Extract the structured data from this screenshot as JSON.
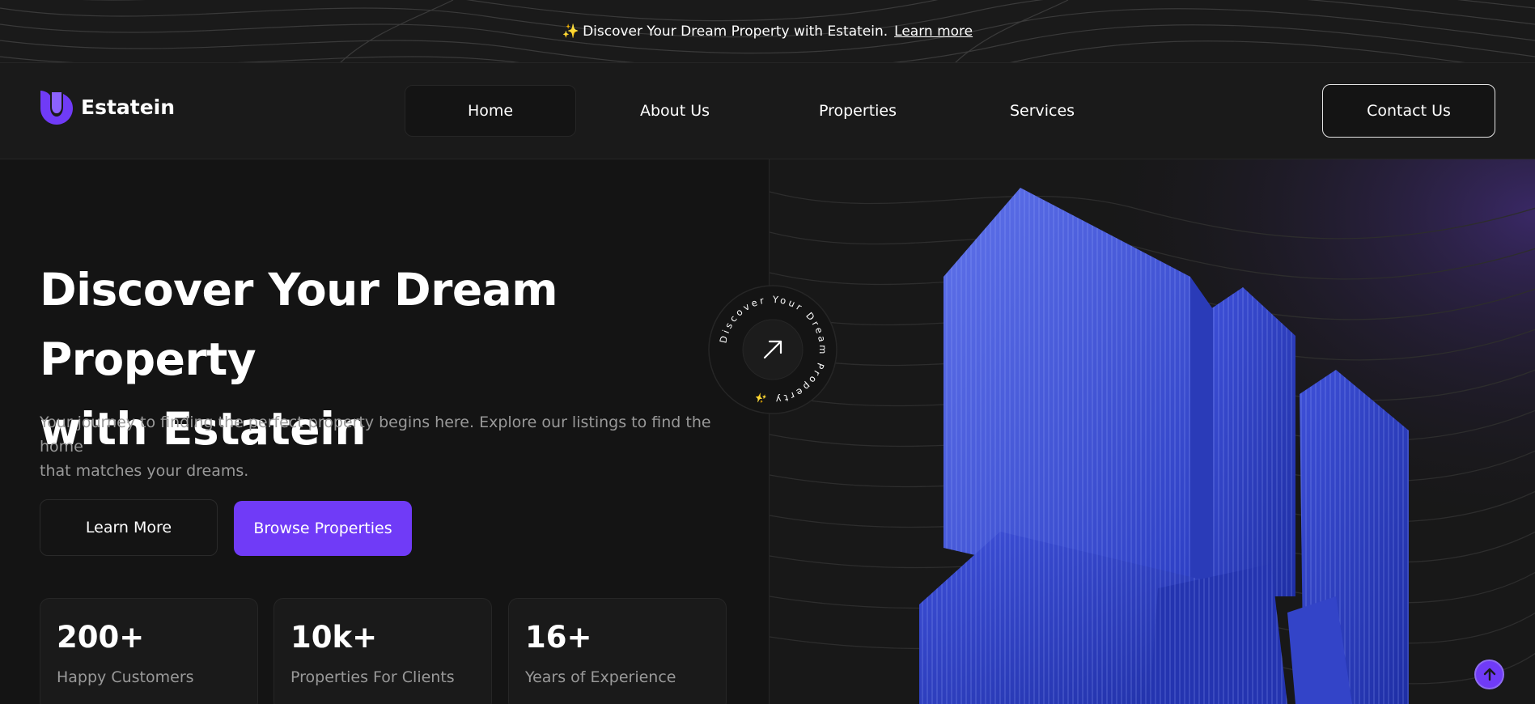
{
  "banner": {
    "text": "Discover Your Dream Property with Estatein.",
    "link": "Learn more"
  },
  "logo": {
    "name": "Estatein"
  },
  "nav": {
    "items": [
      {
        "label": "Home",
        "active": true
      },
      {
        "label": "About Us",
        "active": false
      },
      {
        "label": "Properties",
        "active": false
      },
      {
        "label": "Services",
        "active": false
      }
    ],
    "contact": "Contact Us"
  },
  "hero": {
    "title_line1": "Discover Your Dream Property",
    "title_line2": "with Estatein",
    "description_line1": "Your journey to finding the perfect property begins here. Explore our listings to find the home",
    "description_line2": "that matches your dreams.",
    "learn_more": "Learn More",
    "browse": "Browse Properties"
  },
  "stats": [
    {
      "value": "200+",
      "label": "Happy Customers"
    },
    {
      "value": "10k+",
      "label": "Properties For Clients"
    },
    {
      "value": "16+",
      "label": "Years of Experience"
    }
  ],
  "badge": {
    "text": "Discover Your Dream Property ✨"
  },
  "colors": {
    "accent": "#703bf7",
    "background": "#141414",
    "panel": "#1a1a1a",
    "building": "#3a4bd6"
  },
  "icons": {
    "logo": "logo-mark-icon",
    "sparkle": "sparkle-icon",
    "badge": "arrow-up-right-icon",
    "scroll": "arrow-up-icon"
  }
}
